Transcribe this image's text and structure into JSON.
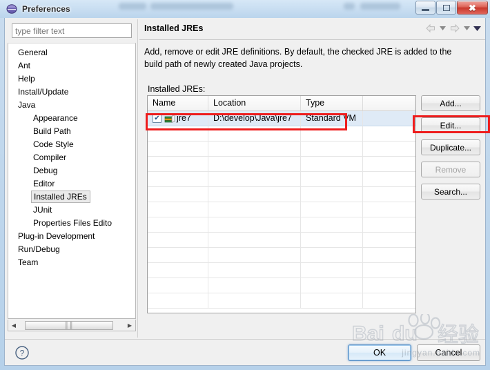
{
  "window": {
    "title": "Preferences",
    "app_icon": "eclipse-sphere-icon",
    "controls": {
      "minimize": "–",
      "maximize": "□",
      "close": "✖"
    }
  },
  "filter": {
    "placeholder": "type filter text",
    "value": ""
  },
  "tree": {
    "items": [
      {
        "label": "General",
        "indent": 0,
        "selected": false
      },
      {
        "label": "Ant",
        "indent": 0,
        "selected": false
      },
      {
        "label": "Help",
        "indent": 0,
        "selected": false
      },
      {
        "label": "Install/Update",
        "indent": 0,
        "selected": false
      },
      {
        "label": "Java",
        "indent": 0,
        "selected": false
      },
      {
        "label": "Appearance",
        "indent": 1,
        "selected": false
      },
      {
        "label": "Build Path",
        "indent": 1,
        "selected": false
      },
      {
        "label": "Code Style",
        "indent": 1,
        "selected": false
      },
      {
        "label": "Compiler",
        "indent": 1,
        "selected": false
      },
      {
        "label": "Debug",
        "indent": 1,
        "selected": false
      },
      {
        "label": "Editor",
        "indent": 1,
        "selected": false
      },
      {
        "label": "Installed JREs",
        "indent": 1,
        "selected": true
      },
      {
        "label": "JUnit",
        "indent": 1,
        "selected": false
      },
      {
        "label": "Properties Files Edito",
        "indent": 1,
        "selected": false
      },
      {
        "label": "Plug-in Development",
        "indent": 0,
        "selected": false
      },
      {
        "label": "Run/Debug",
        "indent": 0,
        "selected": false
      },
      {
        "label": "Team",
        "indent": 0,
        "selected": false
      }
    ],
    "hscroll": {
      "left_arrow": "◀",
      "right_arrow": "▶",
      "grip": "‖‖"
    }
  },
  "page": {
    "title": "Installed JREs",
    "description": "Add, remove or edit JRE definitions. By default, the checked JRE is added to the build path of newly created Java projects.",
    "table_label": "Installed JREs:",
    "nav": {
      "back_icon": "back-arrow-icon",
      "back_menu_icon": "chevron-down-icon",
      "forward_icon": "forward-arrow-icon",
      "forward_menu_icon": "chevron-down-icon",
      "view_menu_icon": "chevron-down-filled-icon"
    }
  },
  "table": {
    "columns": [
      "Name",
      "Location",
      "Type",
      ""
    ],
    "rows": [
      {
        "checked": true,
        "check_glyph": "✔",
        "name": "jre7",
        "location": "D:\\develop\\Java\\jre7",
        "type": "Standard VM",
        "extra": "",
        "selected": true,
        "icon": "jre-library-icon"
      }
    ],
    "empty_row_count": 12
  },
  "side_buttons": [
    {
      "label": "Add...",
      "enabled": true,
      "highlighted": false
    },
    {
      "label": "Edit...",
      "enabled": true,
      "highlighted": true
    },
    {
      "label": "Duplicate...",
      "enabled": true,
      "highlighted": false
    },
    {
      "label": "Remove",
      "enabled": false,
      "highlighted": false
    },
    {
      "label": "Search...",
      "enabled": true,
      "highlighted": false
    }
  ],
  "footer": {
    "help_icon": "help-question-icon",
    "ok_label": "OK",
    "cancel_label": "Cancel"
  },
  "watermark": {
    "text": "Bai du 经验",
    "subtext": "jingyan.baidu.com"
  },
  "colors": {
    "annotation_red": "#ee1c1c",
    "selection_blue": "#dfeaf6",
    "default_button_border": "#5a8fc4"
  }
}
